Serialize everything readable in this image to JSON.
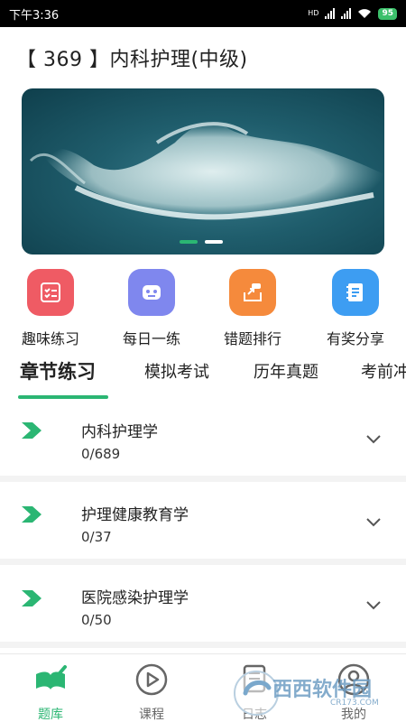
{
  "status_bar": {
    "time": "下午3:36",
    "network": "HD",
    "battery": "95"
  },
  "header": {
    "title": "【 369 】内科护理(中级)"
  },
  "banner": {
    "dots": 2,
    "active_dot": 0
  },
  "quick_actions": [
    {
      "label": "趣味练习",
      "icon": "checklist-icon",
      "color": "#ef5b64"
    },
    {
      "label": "每日一练",
      "icon": "robot-face-icon",
      "color": "#7f87ee"
    },
    {
      "label": "错题排行",
      "icon": "share-box-icon",
      "color": "#f58a3c"
    },
    {
      "label": "有奖分享",
      "icon": "notebook-icon",
      "color": "#3d9df2"
    }
  ],
  "tabs": [
    {
      "label": "章节练习",
      "active": true
    },
    {
      "label": "模拟考试",
      "active": false
    },
    {
      "label": "历年真题",
      "active": false
    },
    {
      "label": "考前冲",
      "active": false
    }
  ],
  "chapters": [
    {
      "title": "内科护理学",
      "count": "0/689"
    },
    {
      "title": "护理健康教育学",
      "count": "0/37"
    },
    {
      "title": "医院感染护理学",
      "count": "0/50"
    }
  ],
  "bottom_nav": [
    {
      "label": "题库",
      "icon": "book-pen-icon",
      "active": true
    },
    {
      "label": "课程",
      "icon": "play-circle-icon",
      "active": false
    },
    {
      "label": "日志",
      "icon": "journal-icon",
      "active": false
    },
    {
      "label": "我的",
      "icon": "user-icon",
      "active": false
    }
  ],
  "watermark": {
    "text": "西西软件园",
    "subtext": "CR173.COM"
  },
  "colors": {
    "accent": "#2bb673",
    "status_bar": "#000000",
    "divider": "#f3f3f3",
    "inactive_nav": "#666666"
  }
}
